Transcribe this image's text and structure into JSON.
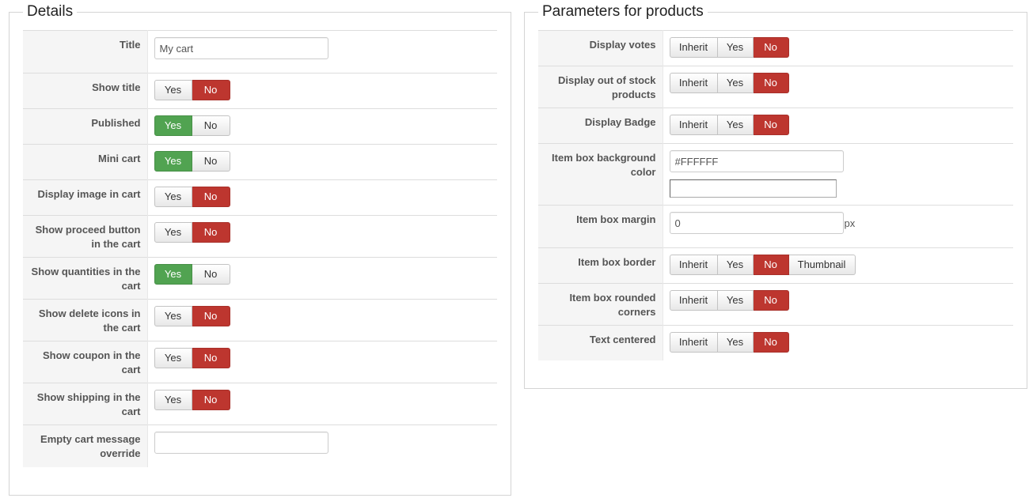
{
  "details": {
    "legend": "Details",
    "title_label": "Title",
    "title_value": "My cart",
    "rows": [
      {
        "label": "Show title",
        "yes": "Yes",
        "no": "No",
        "active": "no"
      },
      {
        "label": "Published",
        "yes": "Yes",
        "no": "No",
        "active": "yes"
      },
      {
        "label": "Mini cart",
        "yes": "Yes",
        "no": "No",
        "active": "yes"
      },
      {
        "label": "Display image in cart",
        "yes": "Yes",
        "no": "No",
        "active": "no"
      },
      {
        "label": "Show proceed button in the cart",
        "yes": "Yes",
        "no": "No",
        "active": "no"
      },
      {
        "label": "Show quantities in the cart",
        "yes": "Yes",
        "no": "No",
        "active": "yes"
      },
      {
        "label": "Show delete icons in the cart",
        "yes": "Yes",
        "no": "No",
        "active": "no"
      },
      {
        "label": "Show coupon in the cart",
        "yes": "Yes",
        "no": "No",
        "active": "no"
      },
      {
        "label": "Show shipping in the cart",
        "yes": "Yes",
        "no": "No",
        "active": "no"
      }
    ],
    "empty_msg_label": "Empty cart message override",
    "empty_msg_value": ""
  },
  "params": {
    "legend": "Parameters for products",
    "display_votes": {
      "label": "Display votes",
      "options": [
        "Inherit",
        "Yes",
        "No"
      ],
      "active": "No"
    },
    "display_out_of_stock": {
      "label": "Display out of stock products",
      "options": [
        "Inherit",
        "Yes",
        "No"
      ],
      "active": "No"
    },
    "display_badge": {
      "label": "Display Badge",
      "options": [
        "Inherit",
        "Yes",
        "No"
      ],
      "active": "No"
    },
    "bg_color": {
      "label": "Item box background color",
      "value": "#FFFFFF",
      "swatch": "#FFFFFF"
    },
    "margin": {
      "label": "Item box margin",
      "value": "0",
      "unit": "px"
    },
    "border": {
      "label": "Item box border",
      "options": [
        "Inherit",
        "Yes",
        "No",
        "Thumbnail"
      ],
      "active": "No"
    },
    "rounded": {
      "label": "Item box rounded corners",
      "options": [
        "Inherit",
        "Yes",
        "No"
      ],
      "active": "No"
    },
    "centered": {
      "label": "Text centered",
      "options": [
        "Inherit",
        "Yes",
        "No"
      ],
      "active": "No"
    }
  },
  "colors": {
    "no_active": "#bd362f",
    "yes_active": "#51a351"
  }
}
